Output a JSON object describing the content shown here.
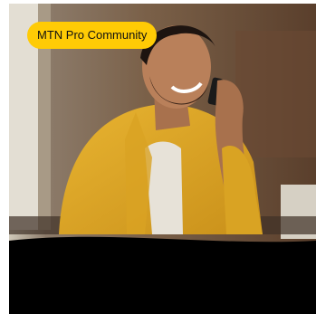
{
  "promo_card": {
    "badge_label": "MTN Pro Community",
    "badge_color": "#ffcb05",
    "image_subject": "man in yellow shirt talking on phone"
  }
}
